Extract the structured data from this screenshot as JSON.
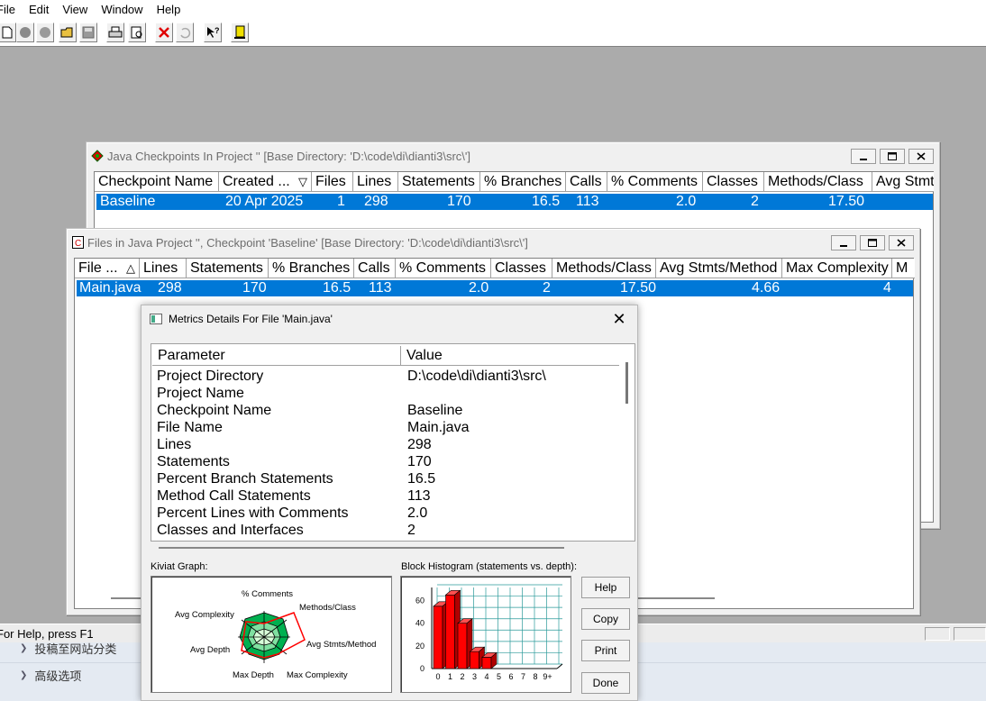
{
  "menu": [
    "File",
    "Edit",
    "View",
    "Window",
    "Help"
  ],
  "toolbar_icons": [
    "new-icon",
    "circle-icon",
    "circle-2-icon",
    "open-folder-icon",
    "save-icon",
    "print-icon",
    "print-preview-icon",
    "delete-icon",
    "undo-icon",
    "context-help-icon",
    "exit-icon"
  ],
  "checkpoints_window": {
    "title": "Java Checkpoints In Project ''   [Base Directory: 'D:\\code\\di\\dianti3\\src\\']",
    "columns": [
      "Checkpoint Name",
      "Created ...",
      "Files",
      "Lines",
      "Statements",
      "% Branches",
      "Calls",
      "% Comments",
      "Classes",
      "Methods/Class",
      "Avg Stmts"
    ],
    "sort_arrow": "▽",
    "row": {
      "name": "Baseline",
      "created": "20 Apr 2025",
      "files": "1",
      "lines": "298",
      "statements": "170",
      "branches": "16.5",
      "calls": "113",
      "comments": "2.0",
      "classes": "2",
      "methods_class": "17.50"
    }
  },
  "files_window": {
    "title": "Files in Java Project '', Checkpoint 'Baseline'  [Base Directory: 'D:\\code\\di\\dianti3\\src\\']",
    "columns": [
      "File ...",
      "Lines",
      "Statements",
      "% Branches",
      "Calls",
      "% Comments",
      "Classes",
      "Methods/Class",
      "Avg Stmts/Method",
      "Max Complexity",
      "M"
    ],
    "sort_arrow": "△",
    "row": {
      "file": "Main.java",
      "lines": "298",
      "statements": "170",
      "branches": "16.5",
      "calls": "113",
      "comments": "2.0",
      "classes": "2",
      "methods_class": "17.50",
      "avg_stmts": "4.66",
      "max_complexity": "4"
    }
  },
  "dialog": {
    "title": "Metrics Details For File 'Main.java'",
    "columns": {
      "parameter": "Parameter",
      "value": "Value"
    },
    "rows": [
      {
        "param": "Project Directory",
        "value": "D:\\code\\di\\dianti3\\src\\"
      },
      {
        "param": "Project Name",
        "value": ""
      },
      {
        "param": "Checkpoint Name",
        "value": "Baseline"
      },
      {
        "param": "File Name",
        "value": "Main.java"
      },
      {
        "param": "Lines",
        "value": "298"
      },
      {
        "param": "Statements",
        "value": "170"
      },
      {
        "param": "Percent Branch Statements",
        "value": "16.5"
      },
      {
        "param": "Method Call Statements",
        "value": "113"
      },
      {
        "param": "Percent Lines with Comments",
        "value": "2.0"
      },
      {
        "param": "Classes and Interfaces",
        "value": "2"
      }
    ],
    "kiviat_label": "Kiviat Graph:",
    "kiviat_axes": [
      "% Comments",
      "Methods/Class",
      "Avg Stmts/Method",
      "Max Complexity",
      "Max Depth",
      "Avg Depth",
      "Avg Complexity"
    ],
    "histogram_label": "Block Histogram (statements vs. depth):",
    "buttons": {
      "help": "Help",
      "copy": "Copy",
      "print": "Print",
      "done": "Done"
    }
  },
  "chart_data": {
    "type": "bar",
    "title": "Block Histogram (statements vs. depth):",
    "categories": [
      "0",
      "1",
      "2",
      "3",
      "4",
      "5",
      "6",
      "7",
      "8",
      "9+"
    ],
    "values": [
      55,
      65,
      40,
      15,
      10,
      0,
      0,
      0,
      0,
      0
    ],
    "y_ticks": [
      "0",
      "20",
      "40",
      "60"
    ],
    "ylim": [
      0,
      70
    ],
    "bar_color": "#ff0000"
  },
  "status": {
    "text": "For Help, press F1"
  },
  "bottom": {
    "row1": "投稿至网站分类",
    "row2": "高级选项"
  }
}
